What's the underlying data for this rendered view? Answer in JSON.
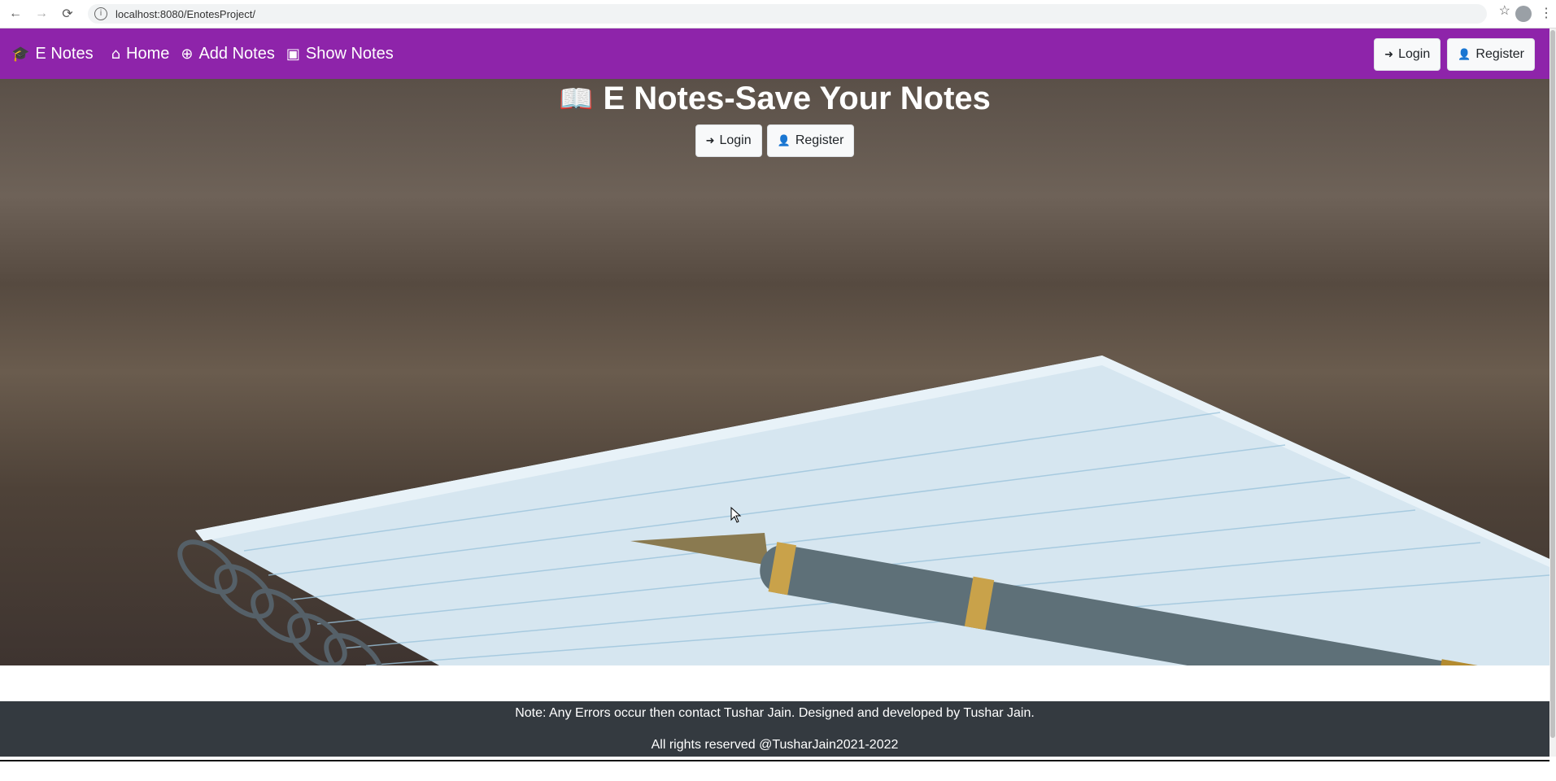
{
  "browser": {
    "url": "localhost:8080/EnotesProject/"
  },
  "navbar": {
    "brand": "E Notes",
    "items": [
      {
        "label": "Home"
      },
      {
        "label": "Add Notes"
      },
      {
        "label": "Show Notes"
      }
    ],
    "login_label": "Login",
    "register_label": "Register",
    "color": "#8e24aa"
  },
  "hero": {
    "title": "E Notes-Save Your Notes",
    "login_label": "Login",
    "register_label": "Register"
  },
  "footer": {
    "note": "Note: Any Errors occur then contact Tushar Jain. Designed and developed by Tushar Jain.",
    "rights": "All rights reserved @TusharJain2021-2022",
    "color": "#343a40"
  },
  "icons": {
    "brand": "graduation-cap-icon",
    "home": "home-icon",
    "add": "plus-circle-icon",
    "show": "address-book-icon",
    "login": "sign-in-icon",
    "register": "user-plus-icon",
    "title": "book-icon"
  }
}
